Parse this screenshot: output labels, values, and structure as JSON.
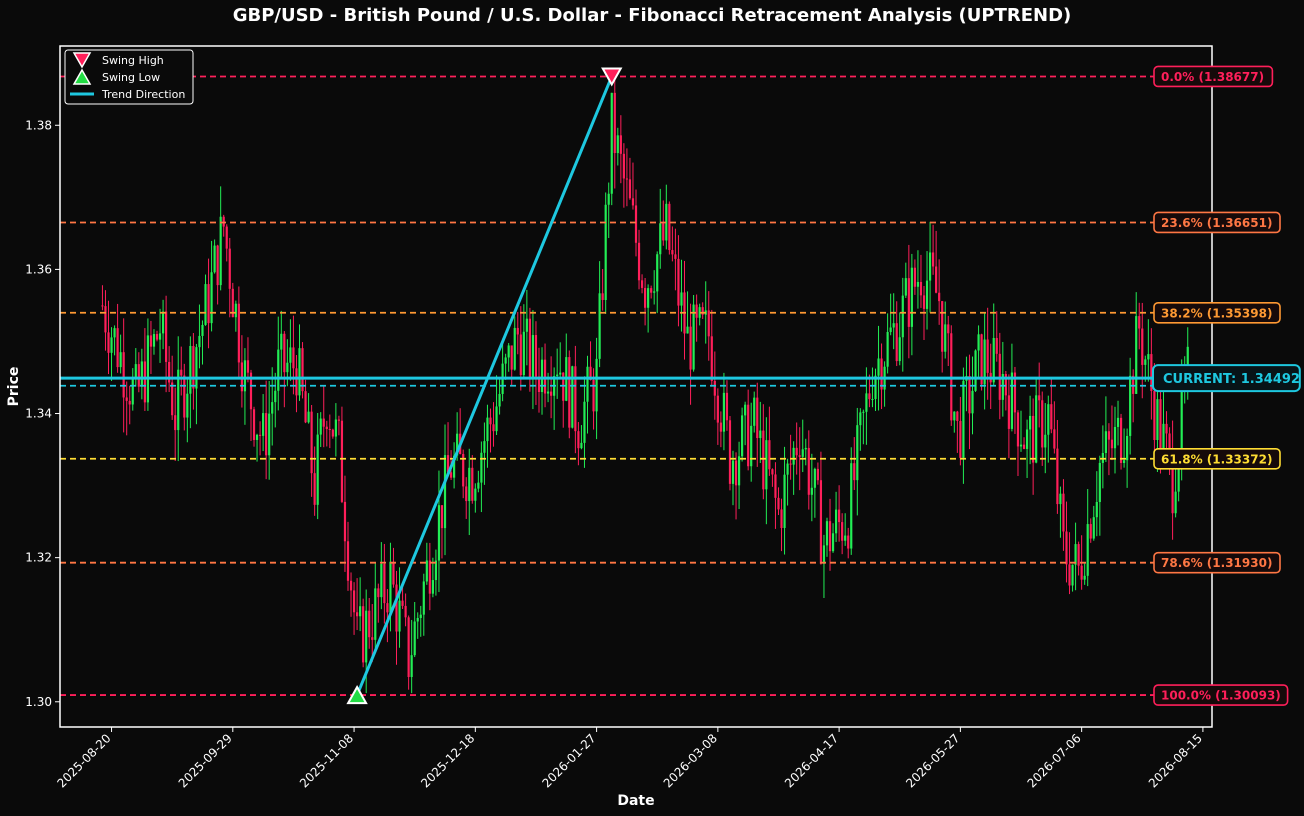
{
  "chart_data": {
    "type": "candlestick",
    "title": "GBP/USD - British Pound / U.S. Dollar - Fibonacci Retracement Analysis (UPTREND)",
    "xlabel": "Date",
    "ylabel": "Price",
    "x_ticks": [
      "2025-08-20",
      "2025-09-29",
      "2025-11-08",
      "2025-12-18",
      "2026-01-27",
      "2026-03-08",
      "2026-04-17",
      "2026-05-27",
      "2026-07-06",
      "2026-08-15"
    ],
    "x_range": [
      "2025-08-03",
      "2026-08-18"
    ],
    "y_ticks": [
      1.3,
      1.32,
      1.34,
      1.36,
      1.38
    ],
    "ylim": [
      1.2965,
      1.391
    ],
    "grid": false,
    "legend_position": "top-left",
    "legend": [
      {
        "label": "Swing High",
        "marker": "down-triangle",
        "color": "#ff1f5a"
      },
      {
        "label": "Swing Low",
        "marker": "up-triangle",
        "color": "#22dd44"
      },
      {
        "label": "Trend Direction",
        "marker": "line",
        "color": "#1ec8e0"
      }
    ],
    "colors": {
      "up": "#22ee55",
      "down": "#ff1f5a",
      "trend": "#1ec8e0",
      "current": "#1ec8e0"
    },
    "swing_high": {
      "date": "2026-02-01",
      "price": 1.38677
    },
    "swing_low": {
      "date": "2025-11-09",
      "price": 1.30093
    },
    "current": {
      "price": 1.34492,
      "label": "CURRENT: 1.34492"
    },
    "fib_levels": [
      {
        "level": "0.0%",
        "price": 1.38677,
        "label": "0.0% (1.38677)",
        "color": "#ff1f5a"
      },
      {
        "level": "23.6%",
        "price": 1.36651,
        "label": "23.6% (1.36651)",
        "color": "#ff7744"
      },
      {
        "level": "38.2%",
        "price": 1.35398,
        "label": "38.2% (1.35398)",
        "color": "#ff9933"
      },
      {
        "level": "50.0%",
        "price": 1.34385,
        "label": "",
        "color": "#1ec8e0"
      },
      {
        "level": "61.8%",
        "price": 1.33372,
        "label": "61.8% (1.33372)",
        "color": "#ffdd33"
      },
      {
        "level": "78.6%",
        "price": 1.3193,
        "label": "78.6% (1.31930)",
        "color": "#ff7744"
      },
      {
        "level": "100.0%",
        "price": 1.30093,
        "label": "100.0% (1.30093)",
        "color": "#ff1f5a"
      }
    ],
    "price_path": [
      {
        "date": "2025-08-17",
        "price": 1.355
      },
      {
        "date": "2025-08-28",
        "price": 1.342
      },
      {
        "date": "2025-09-05",
        "price": 1.352
      },
      {
        "date": "2025-09-10",
        "price": 1.34
      },
      {
        "date": "2025-09-20",
        "price": 1.354
      },
      {
        "date": "2025-09-26",
        "price": 1.366
      },
      {
        "date": "2025-10-03",
        "price": 1.345
      },
      {
        "date": "2025-10-09",
        "price": 1.336
      },
      {
        "date": "2025-10-14",
        "price": 1.346
      },
      {
        "date": "2025-10-20",
        "price": 1.347
      },
      {
        "date": "2025-10-26",
        "price": 1.33
      },
      {
        "date": "2025-10-30",
        "price": 1.342
      },
      {
        "date": "2025-11-03",
        "price": 1.335
      },
      {
        "date": "2025-11-09",
        "price": 1.308
      },
      {
        "date": "2025-11-14",
        "price": 1.312
      },
      {
        "date": "2025-11-20",
        "price": 1.317
      },
      {
        "date": "2025-11-26",
        "price": 1.306
      },
      {
        "date": "2025-12-03",
        "price": 1.32
      },
      {
        "date": "2025-12-10",
        "price": 1.333
      },
      {
        "date": "2025-12-17",
        "price": 1.332
      },
      {
        "date": "2025-12-24",
        "price": 1.34
      },
      {
        "date": "2026-01-01",
        "price": 1.351
      },
      {
        "date": "2026-01-07",
        "price": 1.346
      },
      {
        "date": "2026-01-14",
        "price": 1.348
      },
      {
        "date": "2026-01-21",
        "price": 1.339
      },
      {
        "date": "2026-01-27",
        "price": 1.345
      },
      {
        "date": "2026-02-01",
        "price": 1.38
      },
      {
        "date": "2026-02-05",
        "price": 1.372
      },
      {
        "date": "2026-02-12",
        "price": 1.358
      },
      {
        "date": "2026-02-19",
        "price": 1.365
      },
      {
        "date": "2026-02-26",
        "price": 1.35
      },
      {
        "date": "2026-03-05",
        "price": 1.351
      },
      {
        "date": "2026-03-12",
        "price": 1.334
      },
      {
        "date": "2026-03-20",
        "price": 1.338
      },
      {
        "date": "2026-03-28",
        "price": 1.326
      },
      {
        "date": "2026-04-04",
        "price": 1.338
      },
      {
        "date": "2026-04-12",
        "price": 1.322
      },
      {
        "date": "2026-04-20",
        "price": 1.326
      },
      {
        "date": "2026-04-28",
        "price": 1.346
      },
      {
        "date": "2026-05-06",
        "price": 1.352
      },
      {
        "date": "2026-05-14",
        "price": 1.36
      },
      {
        "date": "2026-05-20",
        "price": 1.356
      },
      {
        "date": "2026-05-26",
        "price": 1.337
      },
      {
        "date": "2026-06-03",
        "price": 1.348
      },
      {
        "date": "2026-06-10",
        "price": 1.345
      },
      {
        "date": "2026-06-18",
        "price": 1.336
      },
      {
        "date": "2026-06-25",
        "price": 1.34
      },
      {
        "date": "2026-06-30",
        "price": 1.321
      },
      {
        "date": "2026-07-05",
        "price": 1.318
      },
      {
        "date": "2026-07-12",
        "price": 1.333
      },
      {
        "date": "2026-07-20",
        "price": 1.338
      },
      {
        "date": "2026-07-25",
        "price": 1.352
      },
      {
        "date": "2026-07-31",
        "price": 1.339
      },
      {
        "date": "2026-08-05",
        "price": 1.331
      },
      {
        "date": "2026-08-10",
        "price": 1.345
      }
    ]
  }
}
